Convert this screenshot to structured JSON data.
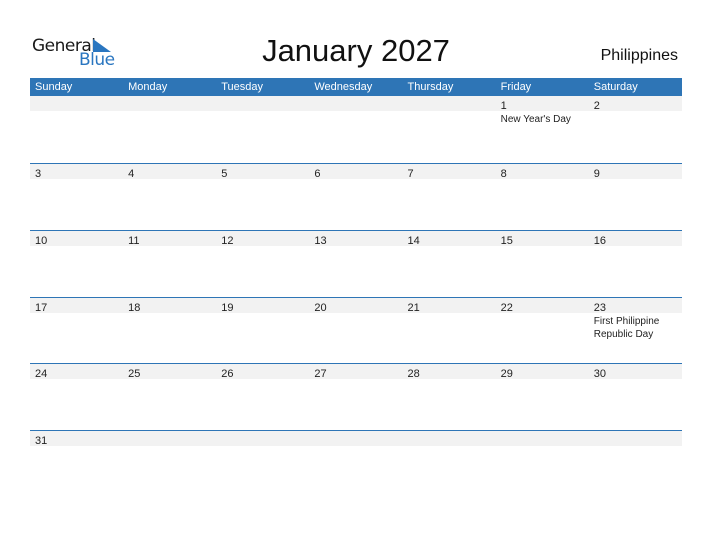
{
  "logo": {
    "general": "General",
    "blue": "Blue"
  },
  "title": "January 2027",
  "country": "Philippines",
  "weekdays": [
    "Sunday",
    "Monday",
    "Tuesday",
    "Wednesday",
    "Thursday",
    "Friday",
    "Saturday"
  ],
  "colors": {
    "header": "#2e75b6",
    "logo_blue": "#2a76c0",
    "row_shade": "#f2f2f2"
  },
  "weeks": [
    {
      "days": [
        "",
        "",
        "",
        "",
        "",
        "1",
        "2"
      ],
      "holidays": [
        "",
        "",
        "",
        "",
        "",
        "New Year's Day",
        ""
      ]
    },
    {
      "days": [
        "3",
        "4",
        "5",
        "6",
        "7",
        "8",
        "9"
      ],
      "holidays": [
        "",
        "",
        "",
        "",
        "",
        "",
        ""
      ]
    },
    {
      "days": [
        "10",
        "11",
        "12",
        "13",
        "14",
        "15",
        "16"
      ],
      "holidays": [
        "",
        "",
        "",
        "",
        "",
        "",
        ""
      ]
    },
    {
      "days": [
        "17",
        "18",
        "19",
        "20",
        "21",
        "22",
        "23"
      ],
      "holidays": [
        "",
        "",
        "",
        "",
        "",
        "",
        "First Philippine Republic Day"
      ]
    },
    {
      "days": [
        "24",
        "25",
        "26",
        "27",
        "28",
        "29",
        "30"
      ],
      "holidays": [
        "",
        "",
        "",
        "",
        "",
        "",
        ""
      ]
    },
    {
      "days": [
        "31",
        "",
        "",
        "",
        "",
        "",
        ""
      ],
      "holidays": [
        "",
        "",
        "",
        "",
        "",
        "",
        ""
      ]
    }
  ]
}
